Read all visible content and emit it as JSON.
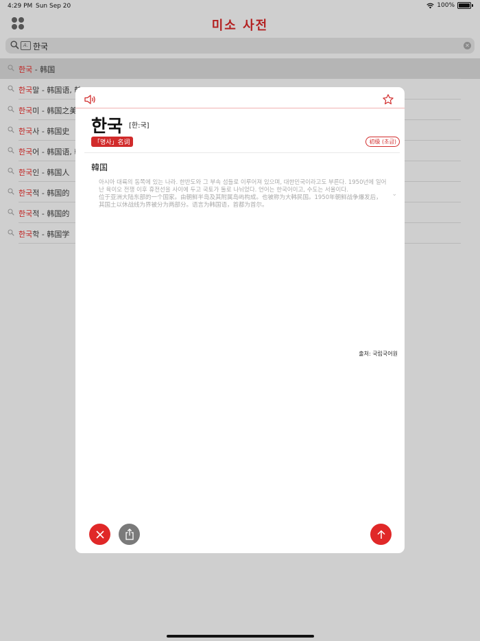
{
  "status_bar": {
    "time": "4:29 PM",
    "date": "Sun Sep 20",
    "battery": "100%"
  },
  "app": {
    "title": "미소 사전"
  },
  "search": {
    "query": "한국",
    "handwriting_icon_label": "A."
  },
  "results": [
    {
      "highlight": "한국",
      "rest": " - 韩国",
      "selected": true
    },
    {
      "highlight": "한국",
      "rest": "말 - 韩国语, 韩"
    },
    {
      "highlight": "한국",
      "rest": "미 - 韩国之美"
    },
    {
      "highlight": "한국",
      "rest": "사 - 韩国史"
    },
    {
      "highlight": "한국",
      "rest": "어 - 韩国语, 韩"
    },
    {
      "highlight": "한국",
      "rest": "인 - 韩国人"
    },
    {
      "highlight": "한국",
      "rest": "적 - 韩国的"
    },
    {
      "highlight": "한국",
      "rest": "적 - 韩国的"
    },
    {
      "highlight": "한국",
      "rest": "학 - 韩国学"
    }
  ],
  "entry": {
    "headword": "한국",
    "pronunciation": "[한:국]",
    "pos": "「명사」名词",
    "level": "初级 (초급)",
    "meaning": "韓国",
    "definition_ko": "아시아 대륙의 동쪽에 있는 나라. 한반도와 그 부속 섬들로 이루어져 있으며, 대한민국이라고도 부른다. 1950년에 일어난 육이오 전쟁 이후 휴전선을 사이에 두고 국토가 둘로 나뉘었다. 언어는 한국어이고, 수도는 서울이다.",
    "definition_zh": "位于亚洲大陆东部的一个国家。由朝鲜半岛及其附属岛屿构成。也被称为大韩民国。1950年朝鲜战争爆发后，其国土以休战线为界被分为两部分。语言为韩国语，首都为首尔。",
    "source": "출처: 국립국어원"
  },
  "colors": {
    "accent": "#d12b2b",
    "highlight": "#c0211f"
  }
}
